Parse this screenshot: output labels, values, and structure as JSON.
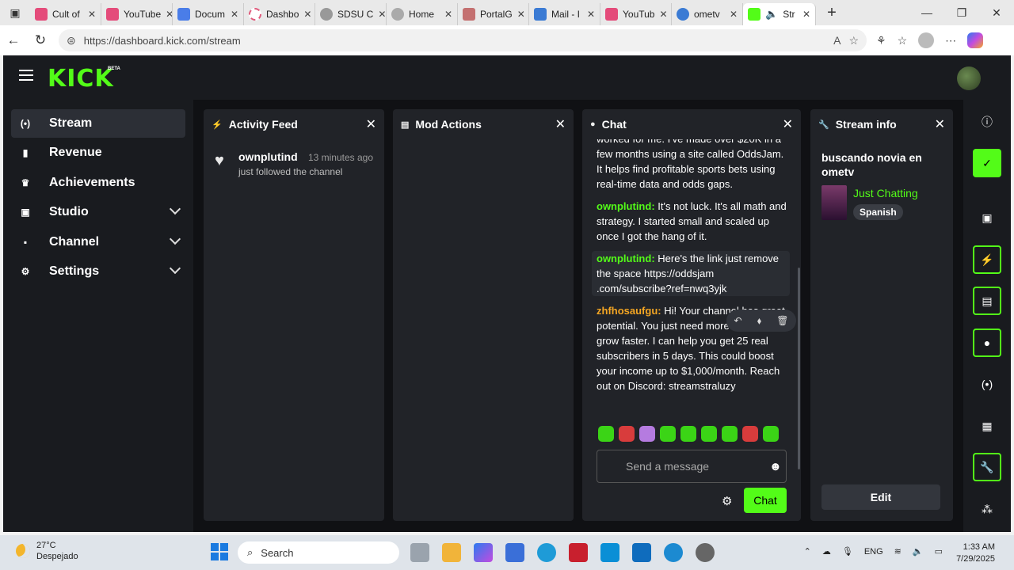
{
  "browser": {
    "tabs": [
      {
        "label": "Cult of",
        "color": "#e44b7a"
      },
      {
        "label": "YouTube",
        "color": "#e44b7a"
      },
      {
        "label": "Docum",
        "color": "#4a7de8"
      },
      {
        "label": "Dashbo",
        "color": "#e05a7c"
      },
      {
        "label": "SDSU C",
        "color": "#888888"
      },
      {
        "label": "Home",
        "color": "#888888"
      },
      {
        "label": "PortalG",
        "color": "#c47070"
      },
      {
        "label": "Mail - I",
        "color": "#3b7bd4"
      },
      {
        "label": "YouTub",
        "color": "#e44b7a"
      },
      {
        "label": "ometv",
        "color": "#3b7bd4"
      },
      {
        "label": "Str",
        "color": "#53fc18"
      }
    ],
    "url": "https://dashboard.kick.com/stream"
  },
  "app": {
    "logo": "KICK",
    "beta": "BETA"
  },
  "sidebar": {
    "items": [
      {
        "label": "Stream",
        "icon": "(•)"
      },
      {
        "label": "Revenue",
        "icon": "▮"
      },
      {
        "label": "Achievements",
        "icon": "🏆"
      },
      {
        "label": "Studio",
        "icon": "▣"
      },
      {
        "label": "Channel",
        "icon": "▪"
      },
      {
        "label": "Settings",
        "icon": "⚙"
      }
    ]
  },
  "activity_feed": {
    "title": "Activity Feed",
    "items": [
      {
        "name": "ownplutind",
        "time": "13 minutes ago",
        "text": "just followed the channel"
      }
    ]
  },
  "mod_actions": {
    "title": "Mod Actions"
  },
  "chat": {
    "title": "Chat",
    "partial_top": "worked for me. I've made over $20K in a few months using a site called OddsJam. It helps find profitable sports bets using real-time data and odds gaps.",
    "messages": [
      {
        "user": "ownplutind",
        "text": " It's not luck. It's all math and strategy. I started small and scaled up once I got the hang of it."
      },
      {
        "user": "ownplutind",
        "text": " Here's the link just remove the space https://oddsjam .com/subscribe?ref=nwq3yjk"
      },
      {
        "user": "zhfhosaufgu",
        "text": " Hi! Your channel has great potential. You just need more support to grow faster. I can help you get 25 real subscribers in 5 days. This could boost your income up to $1,000/month. Reach out on Discord: streamstraluzy"
      }
    ],
    "placeholder": "Send a message",
    "send_label": "Chat"
  },
  "stream_info": {
    "title": "Stream info",
    "stream_title": "buscando novia en ometv",
    "category": "Just Chatting",
    "tag": "Spanish",
    "edit_label": "Edit"
  },
  "taskbar": {
    "temp": "27°C",
    "weather": "Despejado",
    "search": "Search",
    "lang": "ENG",
    "time": "1:33 AM",
    "date": "7/29/2025"
  },
  "colors": {
    "brand": "#53fc18",
    "username_orange": "#f5a623"
  }
}
